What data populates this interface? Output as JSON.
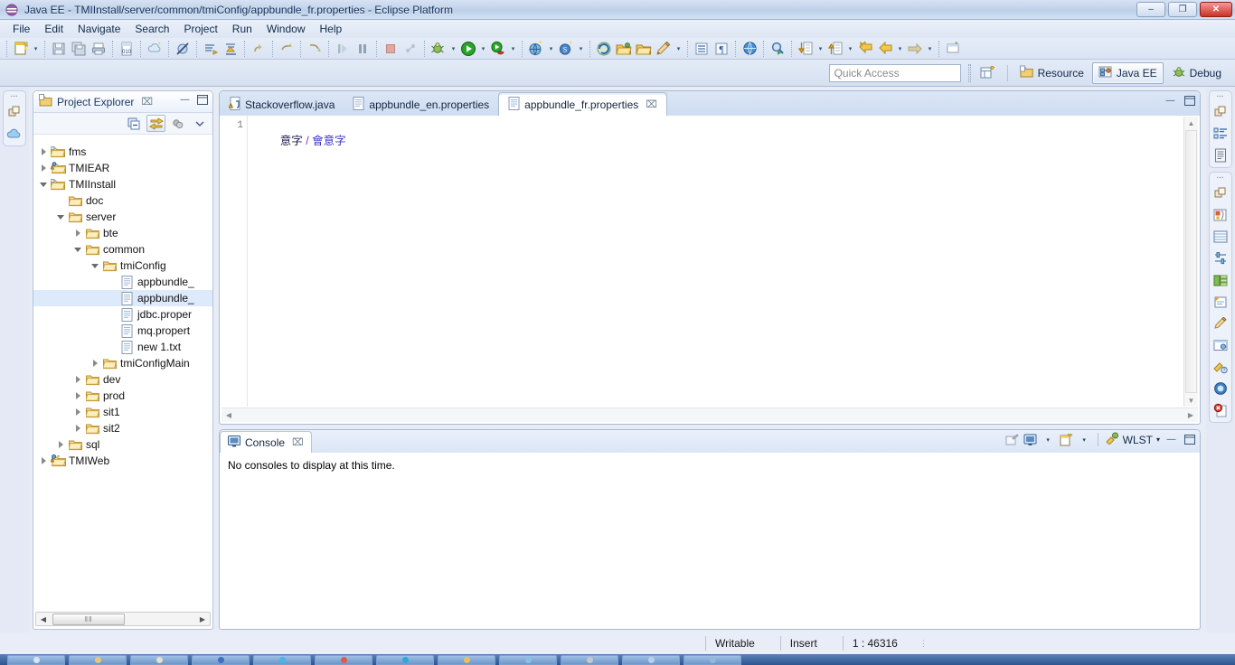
{
  "window": {
    "title": "Java EE - TMIInstall/server/common/tmiConfig/appbundle_fr.properties - Eclipse Platform",
    "app_icon": "eclipse-icon",
    "minimize_label": "–",
    "restore_label": "❐",
    "close_label": "✕"
  },
  "menu": {
    "items": [
      {
        "label": "File",
        "accel": "F"
      },
      {
        "label": "Edit",
        "accel": "E"
      },
      {
        "label": "Navigate",
        "accel": "N"
      },
      {
        "label": "Search",
        "accel": "a"
      },
      {
        "label": "Project",
        "accel": "P"
      },
      {
        "label": "Run",
        "accel": "R"
      },
      {
        "label": "Window",
        "accel": "W"
      },
      {
        "label": "Help",
        "accel": "H"
      }
    ]
  },
  "toolbar": {
    "groups": [
      {
        "buttons": [
          {
            "name": "new-wizard-icon",
            "glyph": "🗋",
            "dropdown": true
          }
        ]
      },
      {
        "buttons": [
          {
            "name": "save-icon",
            "glyph": "💾",
            "dropdown": false
          },
          {
            "name": "save-all-icon",
            "glyph": "🖫",
            "dropdown": false
          },
          {
            "name": "print-icon",
            "glyph": "🖨",
            "dropdown": false
          }
        ]
      },
      {
        "buttons": [
          {
            "name": "build-binary-icon",
            "glyph": "010",
            "dropdown": false
          }
        ]
      },
      {
        "buttons": [
          {
            "name": "new-java-class-icon",
            "glyph": "☁",
            "dropdown": false
          }
        ]
      },
      {
        "buttons": [
          {
            "name": "toggle-breakpoint-icon",
            "glyph": "⊘",
            "dropdown": false
          }
        ]
      },
      {
        "buttons": [
          {
            "name": "open-task-icon",
            "glyph": "≡",
            "dropdown": false
          },
          {
            "name": "skip-breakpoints-icon",
            "glyph": "↯",
            "dropdown": false
          }
        ]
      },
      {
        "buttons": [
          {
            "name": "redo-icon",
            "glyph": "↷",
            "dropdown": false
          }
        ]
      },
      {
        "buttons": [
          {
            "name": "undo-icon",
            "glyph": "↶",
            "dropdown": false
          }
        ]
      },
      {
        "buttons": [
          {
            "name": "step-return-icon",
            "glyph": "↳",
            "dropdown": false
          }
        ]
      },
      {
        "buttons": [
          {
            "name": "resume-icon",
            "glyph": "▶│",
            "dropdown": false
          },
          {
            "name": "suspend-icon",
            "glyph": "▐▐",
            "dropdown": false
          }
        ]
      },
      {
        "buttons": [
          {
            "name": "terminate-icon",
            "glyph": "■",
            "dropdown": false
          },
          {
            "name": "disconnect-icon",
            "glyph": "••",
            "dropdown": false
          }
        ]
      },
      {
        "buttons": [
          {
            "name": "debug-bug-icon",
            "glyph": "🐞",
            "dropdown": true
          },
          {
            "name": "run-icon",
            "glyph": "▶",
            "dropdown": true
          },
          {
            "name": "run-external-tools-icon",
            "glyph": "🔧",
            "dropdown": true
          }
        ]
      },
      {
        "buttons": [
          {
            "name": "new-server-icon",
            "glyph": "🌐",
            "dropdown": true
          },
          {
            "name": "new-ejb-project-icon",
            "glyph": "S",
            "dropdown": true
          }
        ]
      },
      {
        "buttons": [
          {
            "name": "refresh-deploy-icon",
            "glyph": "⟳",
            "dropdown": false
          },
          {
            "name": "open-folder-icon",
            "glyph": "📂",
            "dropdown": false
          },
          {
            "name": "open-folder2-icon",
            "glyph": "🗁",
            "dropdown": false
          },
          {
            "name": "edit-pencil-icon",
            "glyph": "✎",
            "dropdown": true
          }
        ]
      },
      {
        "buttons": [
          {
            "name": "show-whitespace-icon",
            "glyph": "≡",
            "dropdown": false
          },
          {
            "name": "pilcrow-icon",
            "glyph": "¶",
            "dropdown": false
          }
        ]
      },
      {
        "buttons": [
          {
            "name": "open-web-browser-icon",
            "glyph": "🌍",
            "dropdown": false
          }
        ]
      },
      {
        "buttons": [
          {
            "name": "search-run-icon",
            "glyph": "🔍",
            "dropdown": false
          }
        ]
      },
      {
        "buttons": [
          {
            "name": "next-annotation-icon",
            "glyph": "⬇",
            "dropdown": true
          },
          {
            "name": "previous-annotation-icon",
            "glyph": "⬆",
            "dropdown": true
          },
          {
            "name": "back-history-icon",
            "glyph": "⇦",
            "dropdown": false
          },
          {
            "name": "forward-history-icon",
            "glyph": "⬅",
            "dropdown": true
          },
          {
            "name": "forward-arrow-icon",
            "glyph": "➡",
            "dropdown": true
          }
        ]
      },
      {
        "buttons": [
          {
            "name": "new-window-icon",
            "glyph": "🗔",
            "dropdown": false
          }
        ]
      }
    ]
  },
  "perspective": {
    "quick_access_placeholder": "Quick Access",
    "open_perspective_icon": "open-perspective-icon",
    "items": [
      {
        "label": "Resource",
        "icon": "resource-perspective-icon",
        "active": false
      },
      {
        "label": "Java EE",
        "icon": "javaee-perspective-icon",
        "active": true
      },
      {
        "label": "Debug",
        "icon": "debug-perspective-icon",
        "active": false
      }
    ]
  },
  "left_fastview": {
    "groups": [
      {
        "icons": [
          "restore-view-icon",
          "cloud-view-icon"
        ]
      }
    ]
  },
  "right_fastview": {
    "groups": [
      {
        "icons": [
          "restore-view-icon",
          "outline-view-icon",
          "document-view-icon"
        ]
      },
      {
        "icons": [
          "restore-view-icon",
          "palette-view-icon",
          "properties-table-icon",
          "servers-view-icon",
          "data-source-explorer-icon",
          "snippets-view-icon",
          "markers-view-icon",
          "design-view-icon",
          "annotations-view-icon",
          "help-view-icon",
          "problems-view-icon"
        ]
      }
    ]
  },
  "explorer": {
    "title": "Project Explorer",
    "icon": "project-explorer-icon",
    "close_label": "⌧",
    "minimize_label": "—",
    "maximize_label": "❑",
    "toolbar": [
      {
        "name": "collapse-all-button",
        "glyph": "⊟",
        "selected": false
      },
      {
        "name": "link-with-editor-button",
        "glyph": "⇄",
        "selected": true
      },
      {
        "name": "view-menu-filters-button",
        "glyph": "●●",
        "selected": false
      },
      {
        "name": "view-menu-button",
        "glyph": "▽",
        "selected": false
      }
    ],
    "tree": [
      {
        "label": "fms",
        "depth": 0,
        "state": "collapsed",
        "icon": "project-folder-icon",
        "selected": false
      },
      {
        "label": "TMIEAR",
        "depth": 0,
        "state": "collapsed",
        "icon": "ear-project-icon",
        "selected": false
      },
      {
        "label": "TMIInstall",
        "depth": 0,
        "state": "expanded",
        "icon": "project-folder-icon",
        "selected": false
      },
      {
        "label": "doc",
        "depth": 1,
        "state": "leaf",
        "icon": "folder-icon",
        "selected": false
      },
      {
        "label": "server",
        "depth": 1,
        "state": "expanded",
        "icon": "folder-icon",
        "selected": false
      },
      {
        "label": "bte",
        "depth": 2,
        "state": "collapsed",
        "icon": "folder-icon",
        "selected": false
      },
      {
        "label": "common",
        "depth": 2,
        "state": "expanded",
        "icon": "folder-icon",
        "selected": false
      },
      {
        "label": "tmiConfig",
        "depth": 3,
        "state": "expanded",
        "icon": "folder-icon",
        "selected": false
      },
      {
        "label": "appbundle_",
        "depth": 4,
        "state": "leaf",
        "icon": "file-icon",
        "selected": false
      },
      {
        "label": "appbundle_",
        "depth": 4,
        "state": "leaf",
        "icon": "file-icon",
        "selected": true
      },
      {
        "label": "jdbc.proper",
        "depth": 4,
        "state": "leaf",
        "icon": "file-icon",
        "selected": false
      },
      {
        "label": "mq.propert",
        "depth": 4,
        "state": "leaf",
        "icon": "file-icon",
        "selected": false
      },
      {
        "label": "new 1.txt",
        "depth": 4,
        "state": "leaf",
        "icon": "file-icon",
        "selected": false
      },
      {
        "label": "tmiConfigMain",
        "depth": 3,
        "state": "collapsed",
        "icon": "folder-icon",
        "selected": false
      },
      {
        "label": "dev",
        "depth": 2,
        "state": "collapsed",
        "icon": "folder-icon",
        "selected": false
      },
      {
        "label": "prod",
        "depth": 2,
        "state": "collapsed",
        "icon": "folder-icon",
        "selected": false
      },
      {
        "label": "sit1",
        "depth": 2,
        "state": "collapsed",
        "icon": "folder-icon",
        "selected": false
      },
      {
        "label": "sit2",
        "depth": 2,
        "state": "collapsed",
        "icon": "folder-icon",
        "selected": false
      },
      {
        "label": "sql",
        "depth": 1,
        "state": "collapsed",
        "icon": "folder-icon",
        "selected": false
      },
      {
        "label": "TMIWeb",
        "depth": 0,
        "state": "collapsed",
        "icon": "web-project-icon",
        "selected": false
      }
    ],
    "hscroll": {
      "left_arrow": "◀",
      "right_arrow": "▶",
      "thumb_grip": "‖‖"
    }
  },
  "editor": {
    "tabs": [
      {
        "label": "Stackoverflow.java",
        "icon": "java-warning-file-icon",
        "active": false,
        "closable": false
      },
      {
        "label": "appbundle_en.properties",
        "icon": "properties-file-icon",
        "active": false,
        "closable": false
      },
      {
        "label": "appbundle_fr.properties",
        "icon": "properties-file-icon",
        "active": true,
        "closable": true
      }
    ],
    "close_label": "⌧",
    "minimize_label": "—",
    "maximize_label": "❑",
    "lines": [
      {
        "number": "1",
        "tokens": [
          {
            "text": "意字",
            "style": "tok-dark"
          },
          {
            "text": " / ",
            "style": "tok-sep"
          },
          {
            "text": "會意字",
            "style": "tok-blue"
          }
        ]
      }
    ],
    "scroll": {
      "up": "▲",
      "down": "▼",
      "left": "◀",
      "right": "▶"
    }
  },
  "console": {
    "tab_label": "Console",
    "tab_icon": "console-icon",
    "close_label": "⌧",
    "message": "No consoles to display at this time.",
    "toolbar": [
      {
        "name": "open-console-icon",
        "glyph": "❐",
        "dropdown": false
      },
      {
        "name": "display-selected-console-icon",
        "glyph": "🖥",
        "dropdown": true
      },
      {
        "name": "new-console-view-icon",
        "glyph": "🗋",
        "dropdown": true
      }
    ],
    "wlst_label": "WLST",
    "wlst_icon": "wlst-icon",
    "wlst_dropdown": "▾",
    "minimize_label": "—",
    "maximize_label": "❑"
  },
  "statusbar": {
    "writable": "Writable",
    "insert": "Insert",
    "position": "1 : 46316"
  },
  "taskbar": {
    "items": [
      {
        "name": "start-orb",
        "color": "#d8e4f2"
      },
      {
        "name": "taskbar-item-1",
        "color": "#e8c878"
      },
      {
        "name": "taskbar-item-2",
        "color": "#e8e0c8"
      },
      {
        "name": "taskbar-item-3",
        "color": "#3c6fc0"
      },
      {
        "name": "taskbar-item-4",
        "color": "#45b7e8"
      },
      {
        "name": "taskbar-item-5",
        "color": "#e05a45"
      },
      {
        "name": "taskbar-item-6",
        "color": "#2fa8d8"
      },
      {
        "name": "taskbar-item-7",
        "color": "#e8c060"
      },
      {
        "name": "taskbar-item-8",
        "color": "#88c0e8"
      },
      {
        "name": "taskbar-item-9",
        "color": "#c8c8c8"
      },
      {
        "name": "taskbar-item-10",
        "color": "#b8d0e8"
      },
      {
        "name": "taskbar-item-11",
        "color": "#98b8d8"
      }
    ]
  },
  "colors": {
    "chrome": "#d5e0f0",
    "accent": "#3b33c8",
    "selection": "#dceafc",
    "close_button": "#c9322a"
  }
}
